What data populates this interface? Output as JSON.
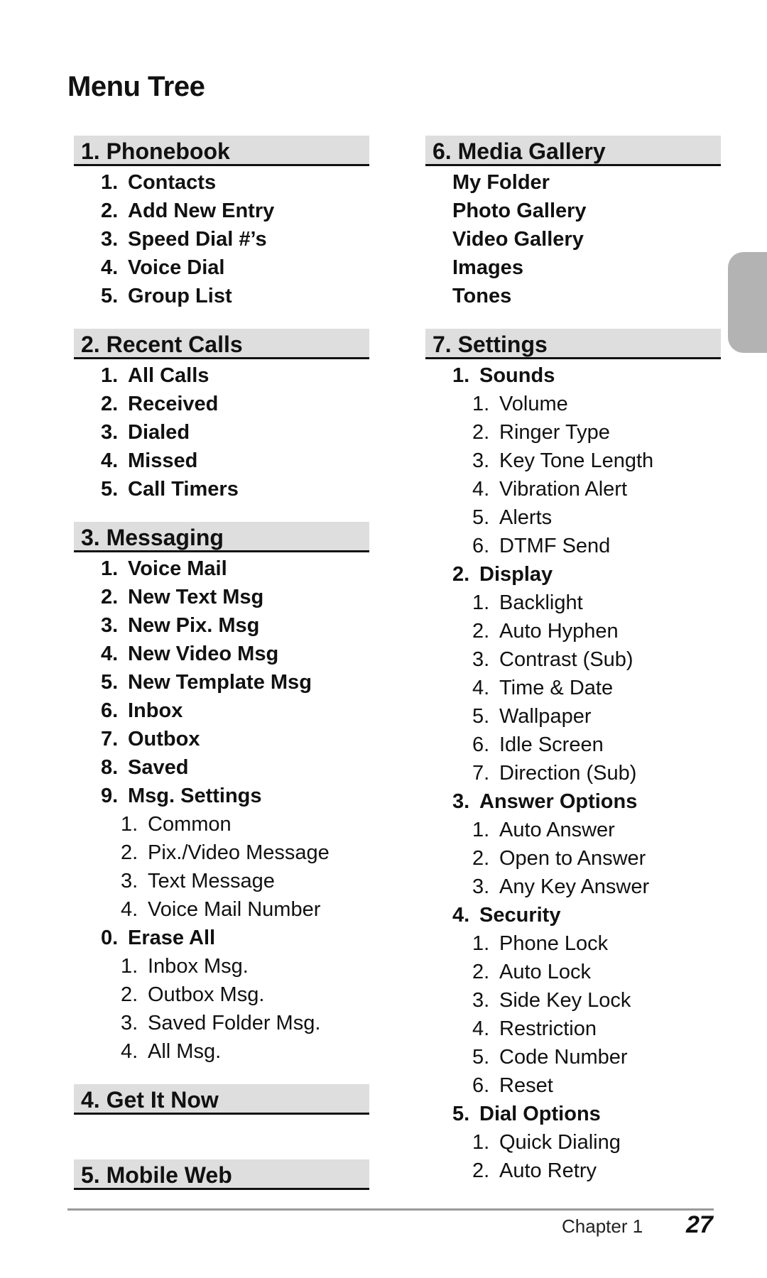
{
  "page": {
    "title": "Menu Tree",
    "footer": {
      "chapter": "Chapter 1",
      "page_number": "27"
    }
  },
  "sections": {
    "phonebook": {
      "title": "1. Phonebook",
      "items": [
        {
          "num": "1.",
          "label": "Contacts"
        },
        {
          "num": "2.",
          "label": "Add New Entry"
        },
        {
          "num": "3.",
          "label": "Speed Dial #’s"
        },
        {
          "num": "4.",
          "label": "Voice Dial"
        },
        {
          "num": "5.",
          "label": "Group List"
        }
      ]
    },
    "recent_calls": {
      "title": "2. Recent Calls",
      "items": [
        {
          "num": "1.",
          "label": "All Calls"
        },
        {
          "num": "2.",
          "label": "Received"
        },
        {
          "num": "3.",
          "label": "Dialed"
        },
        {
          "num": "4.",
          "label": "Missed"
        },
        {
          "num": "5.",
          "label": "Call Timers"
        }
      ]
    },
    "messaging": {
      "title": "3. Messaging",
      "items": [
        {
          "num": "1.",
          "label": "Voice Mail"
        },
        {
          "num": "2.",
          "label": "New Text Msg"
        },
        {
          "num": "3.",
          "label": "New Pix. Msg"
        },
        {
          "num": "4.",
          "label": "New Video Msg"
        },
        {
          "num": "5.",
          "label": "New Template Msg"
        },
        {
          "num": "6.",
          "label": "Inbox"
        },
        {
          "num": "7.",
          "label": "Outbox"
        },
        {
          "num": "8.",
          "label": "Saved"
        },
        {
          "num": "9.",
          "label": "Msg. Settings",
          "children": [
            {
              "num": "1.",
              "label": "Common"
            },
            {
              "num": "2.",
              "label": "Pix./Video Message"
            },
            {
              "num": "3.",
              "label": "Text Message"
            },
            {
              "num": "4.",
              "label": "Voice Mail Number"
            }
          ]
        },
        {
          "num": "0.",
          "label": "Erase All",
          "children": [
            {
              "num": "1.",
              "label": "Inbox Msg."
            },
            {
              "num": "2.",
              "label": "Outbox Msg."
            },
            {
              "num": "3.",
              "label": "Saved Folder Msg."
            },
            {
              "num": "4.",
              "label": "All Msg."
            }
          ]
        }
      ]
    },
    "get_it_now": {
      "title": "4. Get It Now"
    },
    "mobile_web": {
      "title": "5. Mobile Web"
    },
    "media_gallery": {
      "title": "6. Media Gallery",
      "items": [
        {
          "label": "My Folder"
        },
        {
          "label": "Photo Gallery"
        },
        {
          "label": "Video Gallery"
        },
        {
          "label": "Images"
        },
        {
          "label": "Tones"
        }
      ]
    },
    "settings": {
      "title": "7. Settings",
      "items": [
        {
          "num": "1.",
          "label": "Sounds",
          "children": [
            {
              "num": "1.",
              "label": "Volume"
            },
            {
              "num": "2.",
              "label": "Ringer Type"
            },
            {
              "num": "3.",
              "label": "Key Tone Length"
            },
            {
              "num": "4.",
              "label": "Vibration Alert"
            },
            {
              "num": "5.",
              "label": "Alerts"
            },
            {
              "num": "6.",
              "label": "DTMF Send"
            }
          ]
        },
        {
          "num": "2.",
          "label": "Display",
          "children": [
            {
              "num": "1.",
              "label": "Backlight"
            },
            {
              "num": "2.",
              "label": "Auto Hyphen"
            },
            {
              "num": "3.",
              "label": "Contrast (Sub)"
            },
            {
              "num": "4.",
              "label": "Time & Date"
            },
            {
              "num": "5.",
              "label": "Wallpaper"
            },
            {
              "num": "6.",
              "label": "Idle Screen"
            },
            {
              "num": "7.",
              "label": "Direction (Sub)"
            }
          ]
        },
        {
          "num": "3.",
          "label": "Answer Options",
          "children": [
            {
              "num": "1.",
              "label": "Auto Answer"
            },
            {
              "num": "2.",
              "label": "Open to Answer"
            },
            {
              "num": "3.",
              "label": "Any Key Answer"
            }
          ]
        },
        {
          "num": "4.",
          "label": "Security",
          "children": [
            {
              "num": "1.",
              "label": "Phone Lock"
            },
            {
              "num": "2.",
              "label": "Auto Lock"
            },
            {
              "num": "3.",
              "label": "Side Key Lock"
            },
            {
              "num": "4.",
              "label": "Restriction"
            },
            {
              "num": "5.",
              "label": "Code Number"
            },
            {
              "num": "6.",
              "label": "Reset"
            }
          ]
        },
        {
          "num": "5.",
          "label": "Dial Options",
          "children": [
            {
              "num": "1.",
              "label": "Quick Dialing"
            },
            {
              "num": "2.",
              "label": "Auto Retry"
            }
          ]
        }
      ]
    }
  }
}
